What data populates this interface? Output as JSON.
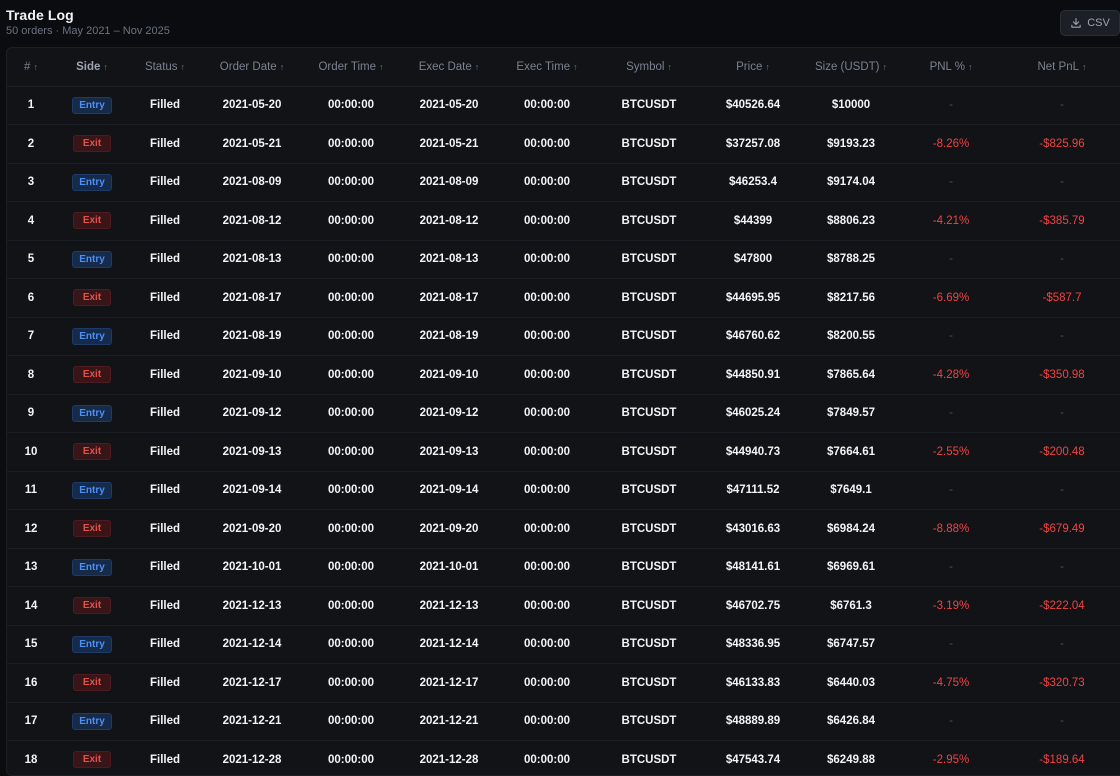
{
  "header": {
    "title": "Trade Log",
    "subtitle": "50 orders · May 2021 – Nov 2025",
    "csv_label": "CSV"
  },
  "columns": [
    "#",
    "Side",
    "Status",
    "Order Date",
    "Order Time",
    "Exec Date",
    "Exec Time",
    "Symbol",
    "Price",
    "Size (USDT)",
    "PNL %",
    "Net PnL"
  ],
  "sort_arrow": "↑",
  "colors": {
    "entry": "#4c8ff5",
    "exit": "#e0524c",
    "negative": "#ef4444",
    "background": "#0b0c10"
  },
  "rows": [
    {
      "n": "1",
      "side": "Entry",
      "status": "Filled",
      "order_date": "2021-05-20",
      "order_time": "00:00:00",
      "exec_date": "2021-05-20",
      "exec_time": "00:00:00",
      "symbol": "BTCUSDT",
      "price": "$40526.64",
      "size": "$10000",
      "pnl_pct": "-",
      "net_pnl": "-"
    },
    {
      "n": "2",
      "side": "Exit",
      "status": "Filled",
      "order_date": "2021-05-21",
      "order_time": "00:00:00",
      "exec_date": "2021-05-21",
      "exec_time": "00:00:00",
      "symbol": "BTCUSDT",
      "price": "$37257.08",
      "size": "$9193.23",
      "pnl_pct": "-8.26%",
      "net_pnl": "-$825.96"
    },
    {
      "n": "3",
      "side": "Entry",
      "status": "Filled",
      "order_date": "2021-08-09",
      "order_time": "00:00:00",
      "exec_date": "2021-08-09",
      "exec_time": "00:00:00",
      "symbol": "BTCUSDT",
      "price": "$46253.4",
      "size": "$9174.04",
      "pnl_pct": "-",
      "net_pnl": "-"
    },
    {
      "n": "4",
      "side": "Exit",
      "status": "Filled",
      "order_date": "2021-08-12",
      "order_time": "00:00:00",
      "exec_date": "2021-08-12",
      "exec_time": "00:00:00",
      "symbol": "BTCUSDT",
      "price": "$44399",
      "size": "$8806.23",
      "pnl_pct": "-4.21%",
      "net_pnl": "-$385.79"
    },
    {
      "n": "5",
      "side": "Entry",
      "status": "Filled",
      "order_date": "2021-08-13",
      "order_time": "00:00:00",
      "exec_date": "2021-08-13",
      "exec_time": "00:00:00",
      "symbol": "BTCUSDT",
      "price": "$47800",
      "size": "$8788.25",
      "pnl_pct": "-",
      "net_pnl": "-"
    },
    {
      "n": "6",
      "side": "Exit",
      "status": "Filled",
      "order_date": "2021-08-17",
      "order_time": "00:00:00",
      "exec_date": "2021-08-17",
      "exec_time": "00:00:00",
      "symbol": "BTCUSDT",
      "price": "$44695.95",
      "size": "$8217.56",
      "pnl_pct": "-6.69%",
      "net_pnl": "-$587.7"
    },
    {
      "n": "7",
      "side": "Entry",
      "status": "Filled",
      "order_date": "2021-08-19",
      "order_time": "00:00:00",
      "exec_date": "2021-08-19",
      "exec_time": "00:00:00",
      "symbol": "BTCUSDT",
      "price": "$46760.62",
      "size": "$8200.55",
      "pnl_pct": "-",
      "net_pnl": "-"
    },
    {
      "n": "8",
      "side": "Exit",
      "status": "Filled",
      "order_date": "2021-09-10",
      "order_time": "00:00:00",
      "exec_date": "2021-09-10",
      "exec_time": "00:00:00",
      "symbol": "BTCUSDT",
      "price": "$44850.91",
      "size": "$7865.64",
      "pnl_pct": "-4.28%",
      "net_pnl": "-$350.98"
    },
    {
      "n": "9",
      "side": "Entry",
      "status": "Filled",
      "order_date": "2021-09-12",
      "order_time": "00:00:00",
      "exec_date": "2021-09-12",
      "exec_time": "00:00:00",
      "symbol": "BTCUSDT",
      "price": "$46025.24",
      "size": "$7849.57",
      "pnl_pct": "-",
      "net_pnl": "-"
    },
    {
      "n": "10",
      "side": "Exit",
      "status": "Filled",
      "order_date": "2021-09-13",
      "order_time": "00:00:00",
      "exec_date": "2021-09-13",
      "exec_time": "00:00:00",
      "symbol": "BTCUSDT",
      "price": "$44940.73",
      "size": "$7664.61",
      "pnl_pct": "-2.55%",
      "net_pnl": "-$200.48"
    },
    {
      "n": "11",
      "side": "Entry",
      "status": "Filled",
      "order_date": "2021-09-14",
      "order_time": "00:00:00",
      "exec_date": "2021-09-14",
      "exec_time": "00:00:00",
      "symbol": "BTCUSDT",
      "price": "$47111.52",
      "size": "$7649.1",
      "pnl_pct": "-",
      "net_pnl": "-"
    },
    {
      "n": "12",
      "side": "Exit",
      "status": "Filled",
      "order_date": "2021-09-20",
      "order_time": "00:00:00",
      "exec_date": "2021-09-20",
      "exec_time": "00:00:00",
      "symbol": "BTCUSDT",
      "price": "$43016.63",
      "size": "$6984.24",
      "pnl_pct": "-8.88%",
      "net_pnl": "-$679.49"
    },
    {
      "n": "13",
      "side": "Entry",
      "status": "Filled",
      "order_date": "2021-10-01",
      "order_time": "00:00:00",
      "exec_date": "2021-10-01",
      "exec_time": "00:00:00",
      "symbol": "BTCUSDT",
      "price": "$48141.61",
      "size": "$6969.61",
      "pnl_pct": "-",
      "net_pnl": "-"
    },
    {
      "n": "14",
      "side": "Exit",
      "status": "Filled",
      "order_date": "2021-12-13",
      "order_time": "00:00:00",
      "exec_date": "2021-12-13",
      "exec_time": "00:00:00",
      "symbol": "BTCUSDT",
      "price": "$46702.75",
      "size": "$6761.3",
      "pnl_pct": "-3.19%",
      "net_pnl": "-$222.04"
    },
    {
      "n": "15",
      "side": "Entry",
      "status": "Filled",
      "order_date": "2021-12-14",
      "order_time": "00:00:00",
      "exec_date": "2021-12-14",
      "exec_time": "00:00:00",
      "symbol": "BTCUSDT",
      "price": "$48336.95",
      "size": "$6747.57",
      "pnl_pct": "-",
      "net_pnl": "-"
    },
    {
      "n": "16",
      "side": "Exit",
      "status": "Filled",
      "order_date": "2021-12-17",
      "order_time": "00:00:00",
      "exec_date": "2021-12-17",
      "exec_time": "00:00:00",
      "symbol": "BTCUSDT",
      "price": "$46133.83",
      "size": "$6440.03",
      "pnl_pct": "-4.75%",
      "net_pnl": "-$320.73"
    },
    {
      "n": "17",
      "side": "Entry",
      "status": "Filled",
      "order_date": "2021-12-21",
      "order_time": "00:00:00",
      "exec_date": "2021-12-21",
      "exec_time": "00:00:00",
      "symbol": "BTCUSDT",
      "price": "$48889.89",
      "size": "$6426.84",
      "pnl_pct": "-",
      "net_pnl": "-"
    },
    {
      "n": "18",
      "side": "Exit",
      "status": "Filled",
      "order_date": "2021-12-28",
      "order_time": "00:00:00",
      "exec_date": "2021-12-28",
      "exec_time": "00:00:00",
      "symbol": "BTCUSDT",
      "price": "$47543.74",
      "size": "$6249.88",
      "pnl_pct": "-2.95%",
      "net_pnl": "-$189.64"
    }
  ]
}
